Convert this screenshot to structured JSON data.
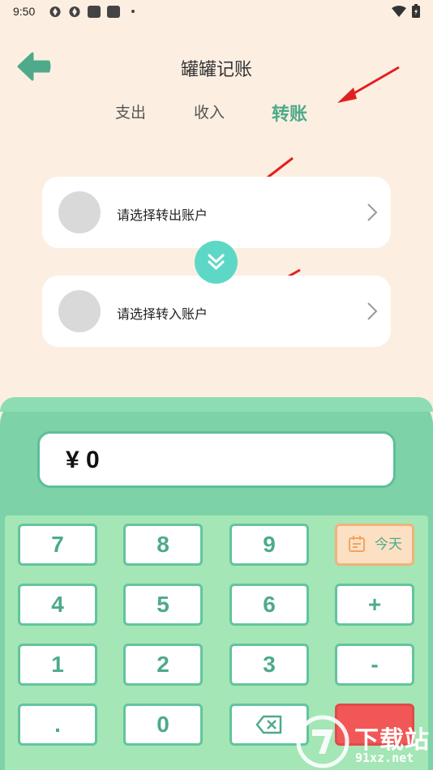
{
  "status_bar": {
    "time": "9:50"
  },
  "header": {
    "title": "罐罐记账"
  },
  "tabs": [
    {
      "label": "支出",
      "active": false
    },
    {
      "label": "收入",
      "active": false
    },
    {
      "label": "转账",
      "active": true
    }
  ],
  "transfer": {
    "from_label": "请选择转出账户",
    "to_label": "请选择转入账户"
  },
  "display": {
    "amount": "¥ 0"
  },
  "keys": {
    "k7": "7",
    "k8": "8",
    "k9": "9",
    "today": "今天",
    "k4": "4",
    "k5": "5",
    "k6": "6",
    "plus": "+",
    "k1": "1",
    "k2": "2",
    "k3": "3",
    "minus": "-",
    "dot": ".",
    "k0": "0"
  },
  "watermark": {
    "line1": "下载站",
    "line2": "91xz.net"
  },
  "colors": {
    "accent": "#4eaa8a",
    "background": "#fcefe2",
    "keypad": "#7dd3a7",
    "annotation": "#e02020"
  }
}
